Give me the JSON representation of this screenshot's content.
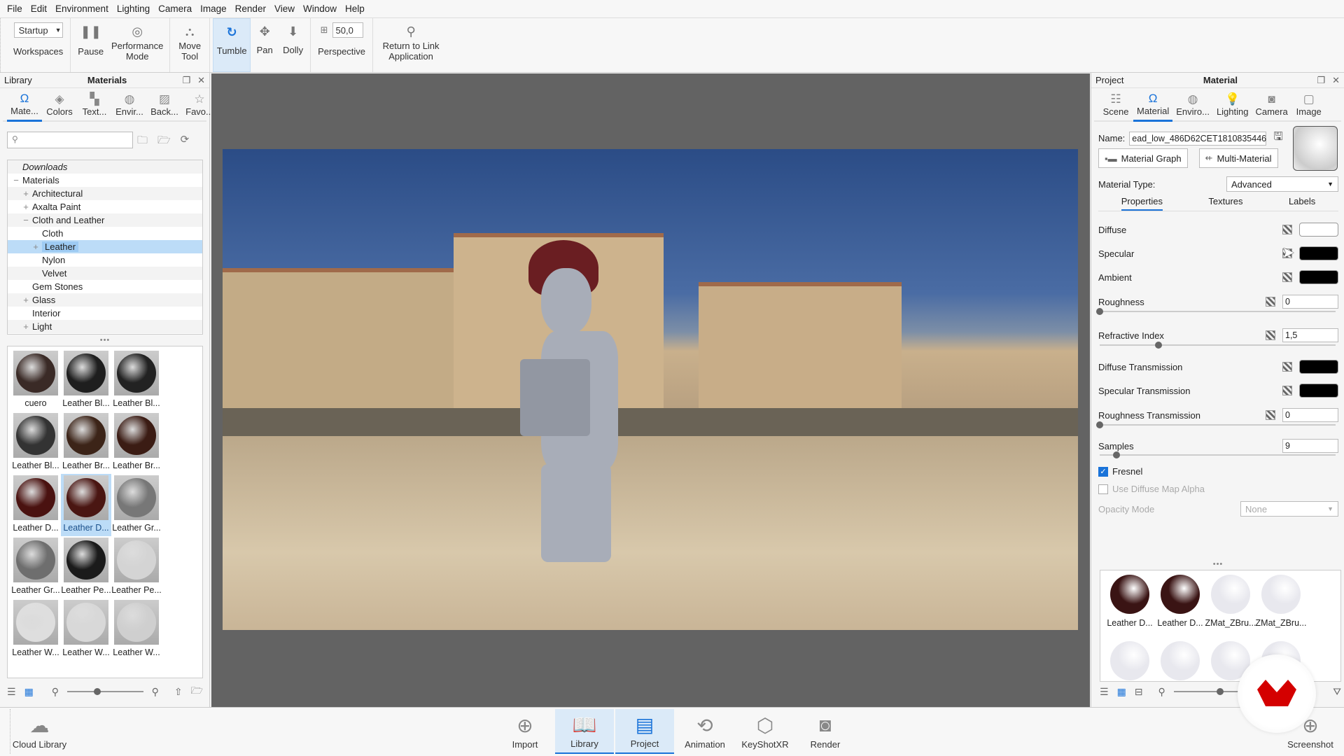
{
  "menu": [
    "File",
    "Edit",
    "Environment",
    "Lighting",
    "Camera",
    "Image",
    "Render",
    "View",
    "Window",
    "Help"
  ],
  "toolbar": {
    "workspace_value": "Startup",
    "workspaces_label": "Workspaces",
    "pause_label": "Pause",
    "performance_label": "Performance Mode",
    "move_label": "Move Tool",
    "tumble_label": "Tumble",
    "pan_label": "Pan",
    "dolly_label": "Dolly",
    "fov_value": "50,0",
    "perspective_label": "Perspective",
    "return_label": "Return to Link Application"
  },
  "library": {
    "panel_tab": "Library",
    "title": "Materials",
    "tabs": [
      {
        "label": "Mate...",
        "icon": "material-icon"
      },
      {
        "label": "Colors",
        "icon": "colors-icon"
      },
      {
        "label": "Text...",
        "icon": "textures-icon"
      },
      {
        "label": "Envir...",
        "icon": "environment-icon"
      },
      {
        "label": "Back...",
        "icon": "backplate-icon"
      },
      {
        "label": "Favo...",
        "icon": "favorites-icon"
      }
    ],
    "search_placeholder": "",
    "tree": [
      {
        "label": "Downloads",
        "level": 0,
        "exp": "",
        "italic": true
      },
      {
        "label": "Materials",
        "level": 0,
        "exp": "−"
      },
      {
        "label": "Architectural",
        "level": 1,
        "exp": "+"
      },
      {
        "label": "Axalta Paint",
        "level": 1,
        "exp": "+"
      },
      {
        "label": "Cloth and Leather",
        "level": 1,
        "exp": "−"
      },
      {
        "label": "Cloth",
        "level": 2,
        "exp": ""
      },
      {
        "label": "Leather",
        "level": 2,
        "exp": "+",
        "selected": true
      },
      {
        "label": "Nylon",
        "level": 2,
        "exp": ""
      },
      {
        "label": "Velvet",
        "level": 2,
        "exp": ""
      },
      {
        "label": "Gem Stones",
        "level": 1,
        "exp": ""
      },
      {
        "label": "Glass",
        "level": 1,
        "exp": "+"
      },
      {
        "label": "Interior",
        "level": 1,
        "exp": ""
      },
      {
        "label": "Light",
        "level": 1,
        "exp": "+"
      }
    ],
    "thumbnails": [
      {
        "label": "cuero",
        "color": "#3a2a26"
      },
      {
        "label": "Leather Bl...",
        "color": "#1e1e1e"
      },
      {
        "label": "Leather Bl...",
        "color": "#222"
      },
      {
        "label": "Leather Bl...",
        "color": "#333"
      },
      {
        "label": "Leather Br...",
        "color": "#3c2418"
      },
      {
        "label": "Leather Br...",
        "color": "#3b1c14"
      },
      {
        "label": "Leather D...",
        "color": "#4a1210"
      },
      {
        "label": "Leather D...",
        "color": "#4a1612",
        "selected": true
      },
      {
        "label": "Leather Gr...",
        "color": "#777"
      },
      {
        "label": "Leather Gr...",
        "color": "#6e6e6e"
      },
      {
        "label": "Leather Pe...",
        "color": "#1b1b1b"
      },
      {
        "label": "Leather Pe...",
        "color": "#d4d4d4"
      },
      {
        "label": "Leather W...",
        "color": "#dedede"
      },
      {
        "label": "Leather W...",
        "color": "#d8d8d8"
      },
      {
        "label": "Leather W...",
        "color": "#cfcfcf"
      }
    ]
  },
  "project": {
    "panel_tab": "Project",
    "title": "Material",
    "tabs": [
      {
        "label": "Scene",
        "icon": "scene-icon"
      },
      {
        "label": "Material",
        "icon": "material-icon",
        "active": true
      },
      {
        "label": "Enviro...",
        "icon": "environment-icon"
      },
      {
        "label": "Lighting",
        "icon": "lighting-icon"
      },
      {
        "label": "Camera",
        "icon": "camera-icon"
      },
      {
        "label": "Image",
        "icon": "image-icon"
      }
    ],
    "name_label": "Name:",
    "name_value": "ead_low_486D62CET1810835446",
    "material_graph_label": "Material Graph",
    "multi_material_label": "Multi-Material",
    "material_type_label": "Material Type:",
    "material_type_value": "Advanced",
    "subtabs": [
      "Properties",
      "Textures",
      "Labels"
    ],
    "properties": {
      "diffuse": {
        "label": "Diffuse",
        "color": "#ffffff"
      },
      "specular": {
        "label": "Specular",
        "color": "#000000"
      },
      "ambient": {
        "label": "Ambient",
        "color": "#000000"
      },
      "roughness": {
        "label": "Roughness",
        "value": "0",
        "fraction": 0.0
      },
      "refractive_index": {
        "label": "Refractive Index",
        "value": "1,5",
        "fraction": 0.25
      },
      "diffuse_transmission": {
        "label": "Diffuse Transmission",
        "color": "#000000"
      },
      "specular_transmission": {
        "label": "Specular Transmission",
        "color": "#000000"
      },
      "roughness_transmission": {
        "label": "Roughness Transmission",
        "value": "0",
        "fraction": 0.0
      },
      "samples": {
        "label": "Samples",
        "value": "9",
        "fraction": 0.07
      },
      "fresnel": {
        "label": "Fresnel",
        "checked": true
      },
      "use_diffuse_alpha": {
        "label": "Use Diffuse Map Alpha",
        "checked": false
      },
      "opacity_mode": {
        "label": "Opacity Mode",
        "value": "None"
      }
    },
    "thumbnails": [
      {
        "label": "Leather D...",
        "color": "#3a1414"
      },
      {
        "label": "Leather D...",
        "color": "#3a1414"
      },
      {
        "label": "ZMat_ZBru...",
        "color": "#e8e8ee"
      },
      {
        "label": "ZMat_ZBru...",
        "color": "#e8e8ee"
      },
      {
        "label": "",
        "color": "#e8e8ee"
      },
      {
        "label": "",
        "color": "#e8e8ee"
      },
      {
        "label": "",
        "color": "#e8e8ee"
      },
      {
        "label": "",
        "color": "#e8e8ee"
      }
    ]
  },
  "bottombar": {
    "cloud_library": "Cloud Library",
    "items": [
      {
        "label": "Import",
        "icon": "import-icon"
      },
      {
        "label": "Library",
        "icon": "library-icon",
        "active": true
      },
      {
        "label": "Project",
        "icon": "project-icon",
        "active": true
      },
      {
        "label": "Animation",
        "icon": "animation-icon"
      },
      {
        "label": "KeyShotXR",
        "icon": "keyshotxr-icon"
      },
      {
        "label": "Render",
        "icon": "render-icon"
      }
    ],
    "screenshot": "Screenshot"
  },
  "colors": {
    "accent": "#1a73d9",
    "logo_red": "#d40000"
  }
}
